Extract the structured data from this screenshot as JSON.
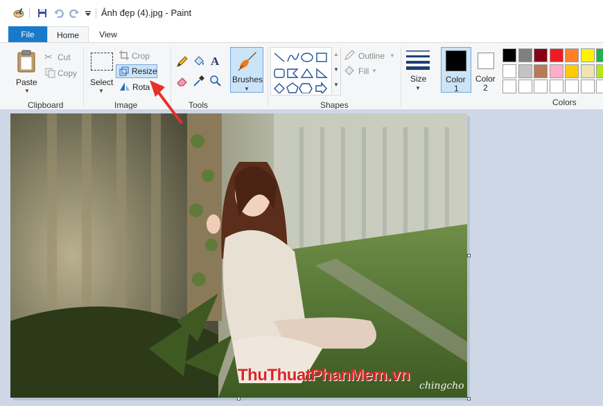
{
  "window": {
    "title": "Ảnh đẹp (4).jpg - Paint"
  },
  "tabs": {
    "file": "File",
    "home": "Home",
    "view": "View"
  },
  "clipboard": {
    "paste": "Paste",
    "cut": "Cut",
    "copy": "Copy",
    "group": "Clipboard"
  },
  "image": {
    "select": "Select",
    "crop": "Crop",
    "resize": "Resize",
    "rotate": "Rota",
    "group": "Image"
  },
  "tools": {
    "text_glyph": "A",
    "group": "Tools"
  },
  "brushes": {
    "label": "Brushes"
  },
  "shapes": {
    "outline": "Outline",
    "fill": "Fill",
    "group": "Shapes"
  },
  "size": {
    "label": "Size"
  },
  "color1": {
    "line1": "Color",
    "line2": "1",
    "value": "#000000"
  },
  "color2": {
    "line1": "Color",
    "line2": "2",
    "value": "#ffffff"
  },
  "colors": {
    "group": "Colors",
    "row1": [
      "#000000",
      "#7f7f7f",
      "#880015",
      "#ed1c24",
      "#ff7f27",
      "#fff200",
      "#22b14c"
    ],
    "row2": [
      "#ffffff",
      "#c3c3c3",
      "#b97a57",
      "#ffaec9",
      "#ffc90e",
      "#efe4b0",
      "#b5e61d"
    ],
    "row3": [
      "#ffffff",
      "#ffffff",
      "#ffffff",
      "#ffffff",
      "#ffffff",
      "#ffffff",
      "#ffffff"
    ]
  },
  "canvas": {
    "watermark": "ThuThuatPhanMem.vn",
    "signature": "chingcho"
  },
  "accent": "#1979ca",
  "annotation_arrow_color": "#e8302a"
}
